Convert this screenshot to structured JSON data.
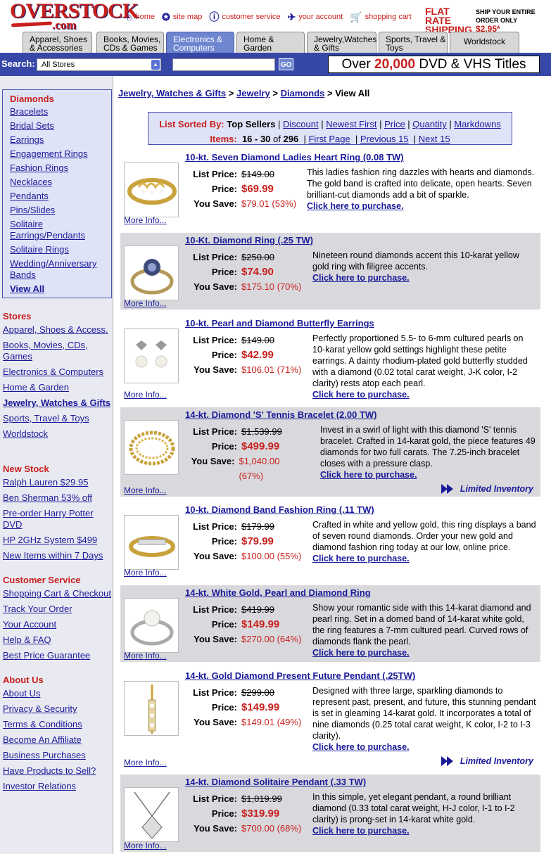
{
  "header": {
    "logo_text": "OVERSTOCK",
    "logo_suffix": ".com",
    "links": [
      {
        "icon": "home-icon",
        "glyph": "⌂",
        "label": "home"
      },
      {
        "icon": "site-map-icon",
        "glyph": "✪",
        "label": "site map"
      },
      {
        "icon": "info-icon",
        "glyph": "ⓘ",
        "label": "customer service"
      },
      {
        "icon": "account-icon",
        "glyph": "✈",
        "label": "your account"
      },
      {
        "icon": "cart-icon",
        "glyph": "🛒",
        "label": "shopping cart"
      }
    ],
    "flat_rate": "FLAT RATE SHIPPING",
    "ship_entire": "SHIP YOUR ENTIRE",
    "order_only": "ORDER ONLY",
    "ship_price": "$2.95*"
  },
  "tabs": [
    {
      "label": "Apparel, Shoes & Accessories",
      "active": false
    },
    {
      "label": "Books, Movies, CDs & Games",
      "active": false
    },
    {
      "label": "Electronics & Computers",
      "active": true
    },
    {
      "label": "Home & Garden",
      "active": false
    },
    {
      "label": "Jewelry,Watches & Gifts",
      "active": false
    },
    {
      "label": "Sports, Travel & Toys",
      "active": false
    },
    {
      "label": "Worldstock",
      "active": false
    }
  ],
  "search": {
    "label": "Search:",
    "scope": "All Stores",
    "go": "GO",
    "promo_pre": "Over ",
    "promo_num": "20,000",
    "promo_post": " DVD & VHS Titles"
  },
  "sidebar": {
    "category_title": "Diamonds",
    "categories": [
      "Bracelets",
      "Bridal Sets",
      "Earrings",
      "Engagement Rings",
      "Fashion Rings",
      "Necklaces",
      "Pendants",
      "Pins/Slides",
      "Solitaire Earrings/Pendants",
      "Solitaire Rings",
      "Wedding/Anniversary Bands"
    ],
    "view_all": "View All",
    "stores_title": "Stores",
    "stores": [
      "Apparel, Shoes & Access.",
      "Books, Movies, CDs, Games",
      "Electronics & Computers",
      "Home & Garden",
      "Jewelry, Watches & Gifts",
      "Sports, Travel & Toys",
      "Worldstock"
    ],
    "new_title": "New Stock",
    "new_items": [
      "Ralph Lauren $29.95",
      "Ben Sherman 53% off",
      "Pre-order Harry Potter DVD",
      "HP 2GHz System $499",
      "New Items within 7 Days"
    ],
    "cs_title": "Customer Service",
    "cs_items": [
      "Shopping Cart & Checkout",
      "Track Your Order",
      "Your Account",
      "Help & FAQ",
      "Best Price Guarantee"
    ],
    "about_title": "About Us",
    "about_items": [
      "About Us",
      "Privacy & Security",
      "Terms & Conditions",
      "Become An Affiliate",
      "Business Purchases",
      "Have Products to Sell?",
      "Investor Relations"
    ]
  },
  "breadcrumb": {
    "items": [
      "Jewelry, Watches & Gifts",
      "Jewelry",
      "Diamonds"
    ],
    "current": "View All",
    "sep": ">"
  },
  "sort": {
    "label": "List Sorted By:",
    "current": "Top Sellers",
    "options": [
      "Discount",
      "Newest First",
      "Price",
      "Quantity",
      "Markdowns"
    ],
    "items_label": "Items:",
    "range": "16 - 30",
    "of": "of",
    "total": "296",
    "first": "First Page",
    "prev": "Previous 15",
    "next": "Next 15"
  },
  "labels": {
    "list_price": "List Price:",
    "price": "Price:",
    "you_save": "You Save:",
    "more_info": "More Info...",
    "purchase": "Click here to purchase.",
    "limited": "Limited Inventory"
  },
  "products": [
    {
      "title": "10-kt. Seven Diamond Ladies Heart Ring (0.08 TW)",
      "list": "$149.00",
      "price": "$69.99",
      "save": "$79.01 (53%)",
      "desc": "This ladies fashion ring dazzles with hearts and diamonds. The gold band is crafted into delicate, open hearts. Seven brilliant-cut diamonds add a bit of sparkle.",
      "limited": false,
      "icon": "heart-ring-image"
    },
    {
      "title": "10-Kt. Diamond Ring (.25 TW)",
      "list": "$250.00",
      "price": "$74.90",
      "save": "$175.10 (70%)",
      "desc": "Nineteen round diamonds accent this 10-karat yellow gold ring with filigree accents.",
      "limited": false,
      "icon": "diamond-ring-image"
    },
    {
      "title": "10-kt. Pearl and Diamond Butterfly Earrings",
      "list": "$149.00",
      "price": "$42.99",
      "save": "$106.01 (71%)",
      "desc": "Perfectly proportioned 5.5- to 6-mm cultured pearls on 10-karat yellow gold settings highlight these petite earrings. A dainty rhodium-plated gold butterfly studded with a diamond (0.02 total carat weight, J-K color, I-2 clarity) rests atop each pearl.",
      "limited": false,
      "icon": "butterfly-earrings-image"
    },
    {
      "title": "14-kt. Diamond 'S' Tennis Bracelet (2.00 TW)",
      "list": "$1,539.99",
      "price": "$499.99",
      "save": "$1,040.00 (67%)",
      "desc": "Invest in a swirl of light with this diamond 'S' tennis bracelet. Crafted in 14-karat gold, the piece features 49 diamonds for two full carats. The 7.25-inch bracelet closes with a pressure clasp.",
      "limited": true,
      "icon": "tennis-bracelet-image"
    },
    {
      "title": "10-kt. Diamond Band Fashion Ring (.11 TW)",
      "list": "$179.99",
      "price": "$79.99",
      "save": "$100.00 (55%)",
      "desc": "Crafted in white and yellow gold, this ring displays a band of seven round diamonds. Order your new gold and diamond fashion ring today at our low, online price.",
      "limited": false,
      "icon": "band-ring-image"
    },
    {
      "title": "14-kt. White Gold, Pearl and Diamond Ring",
      "list": "$419.99",
      "price": "$149.99",
      "save": "$270.00 (64%)",
      "desc": "Show your romantic side with this 14-karat diamond and pearl ring. Set in a domed band of 14-karat white gold, the ring features a 7-mm cultured pearl. Curved rows of diamonds flank the pearl.",
      "limited": false,
      "icon": "pearl-ring-image"
    },
    {
      "title": "14-kt. Gold Diamond Present Future Pendant (.25TW)",
      "list": "$299.00",
      "price": "$149.99",
      "save": "$149.01 (49%)",
      "desc": "Designed with three large, sparkling diamonds to represent past, present, and future, this stunning pendant is set in gleaming 14-karat gold. It incorporates a total of nine diamonds (0.25 total carat weight, K color, I-2 to I-3 clarity).",
      "limited": true,
      "icon": "pendant-image"
    },
    {
      "title": "14-kt. Diamond Solitaire Pendant (.33 TW)",
      "list": "$1,019.99",
      "price": "$319.99",
      "save": "$700.00 (68%)",
      "desc": "In this simple, yet elegant pendant, a round brilliant diamond (0.33 total carat weight, H-J color, I-1 to I-2 clarity) is prong-set in 14-karat white gold.",
      "limited": false,
      "icon": "solitaire-pendant-image"
    }
  ]
}
